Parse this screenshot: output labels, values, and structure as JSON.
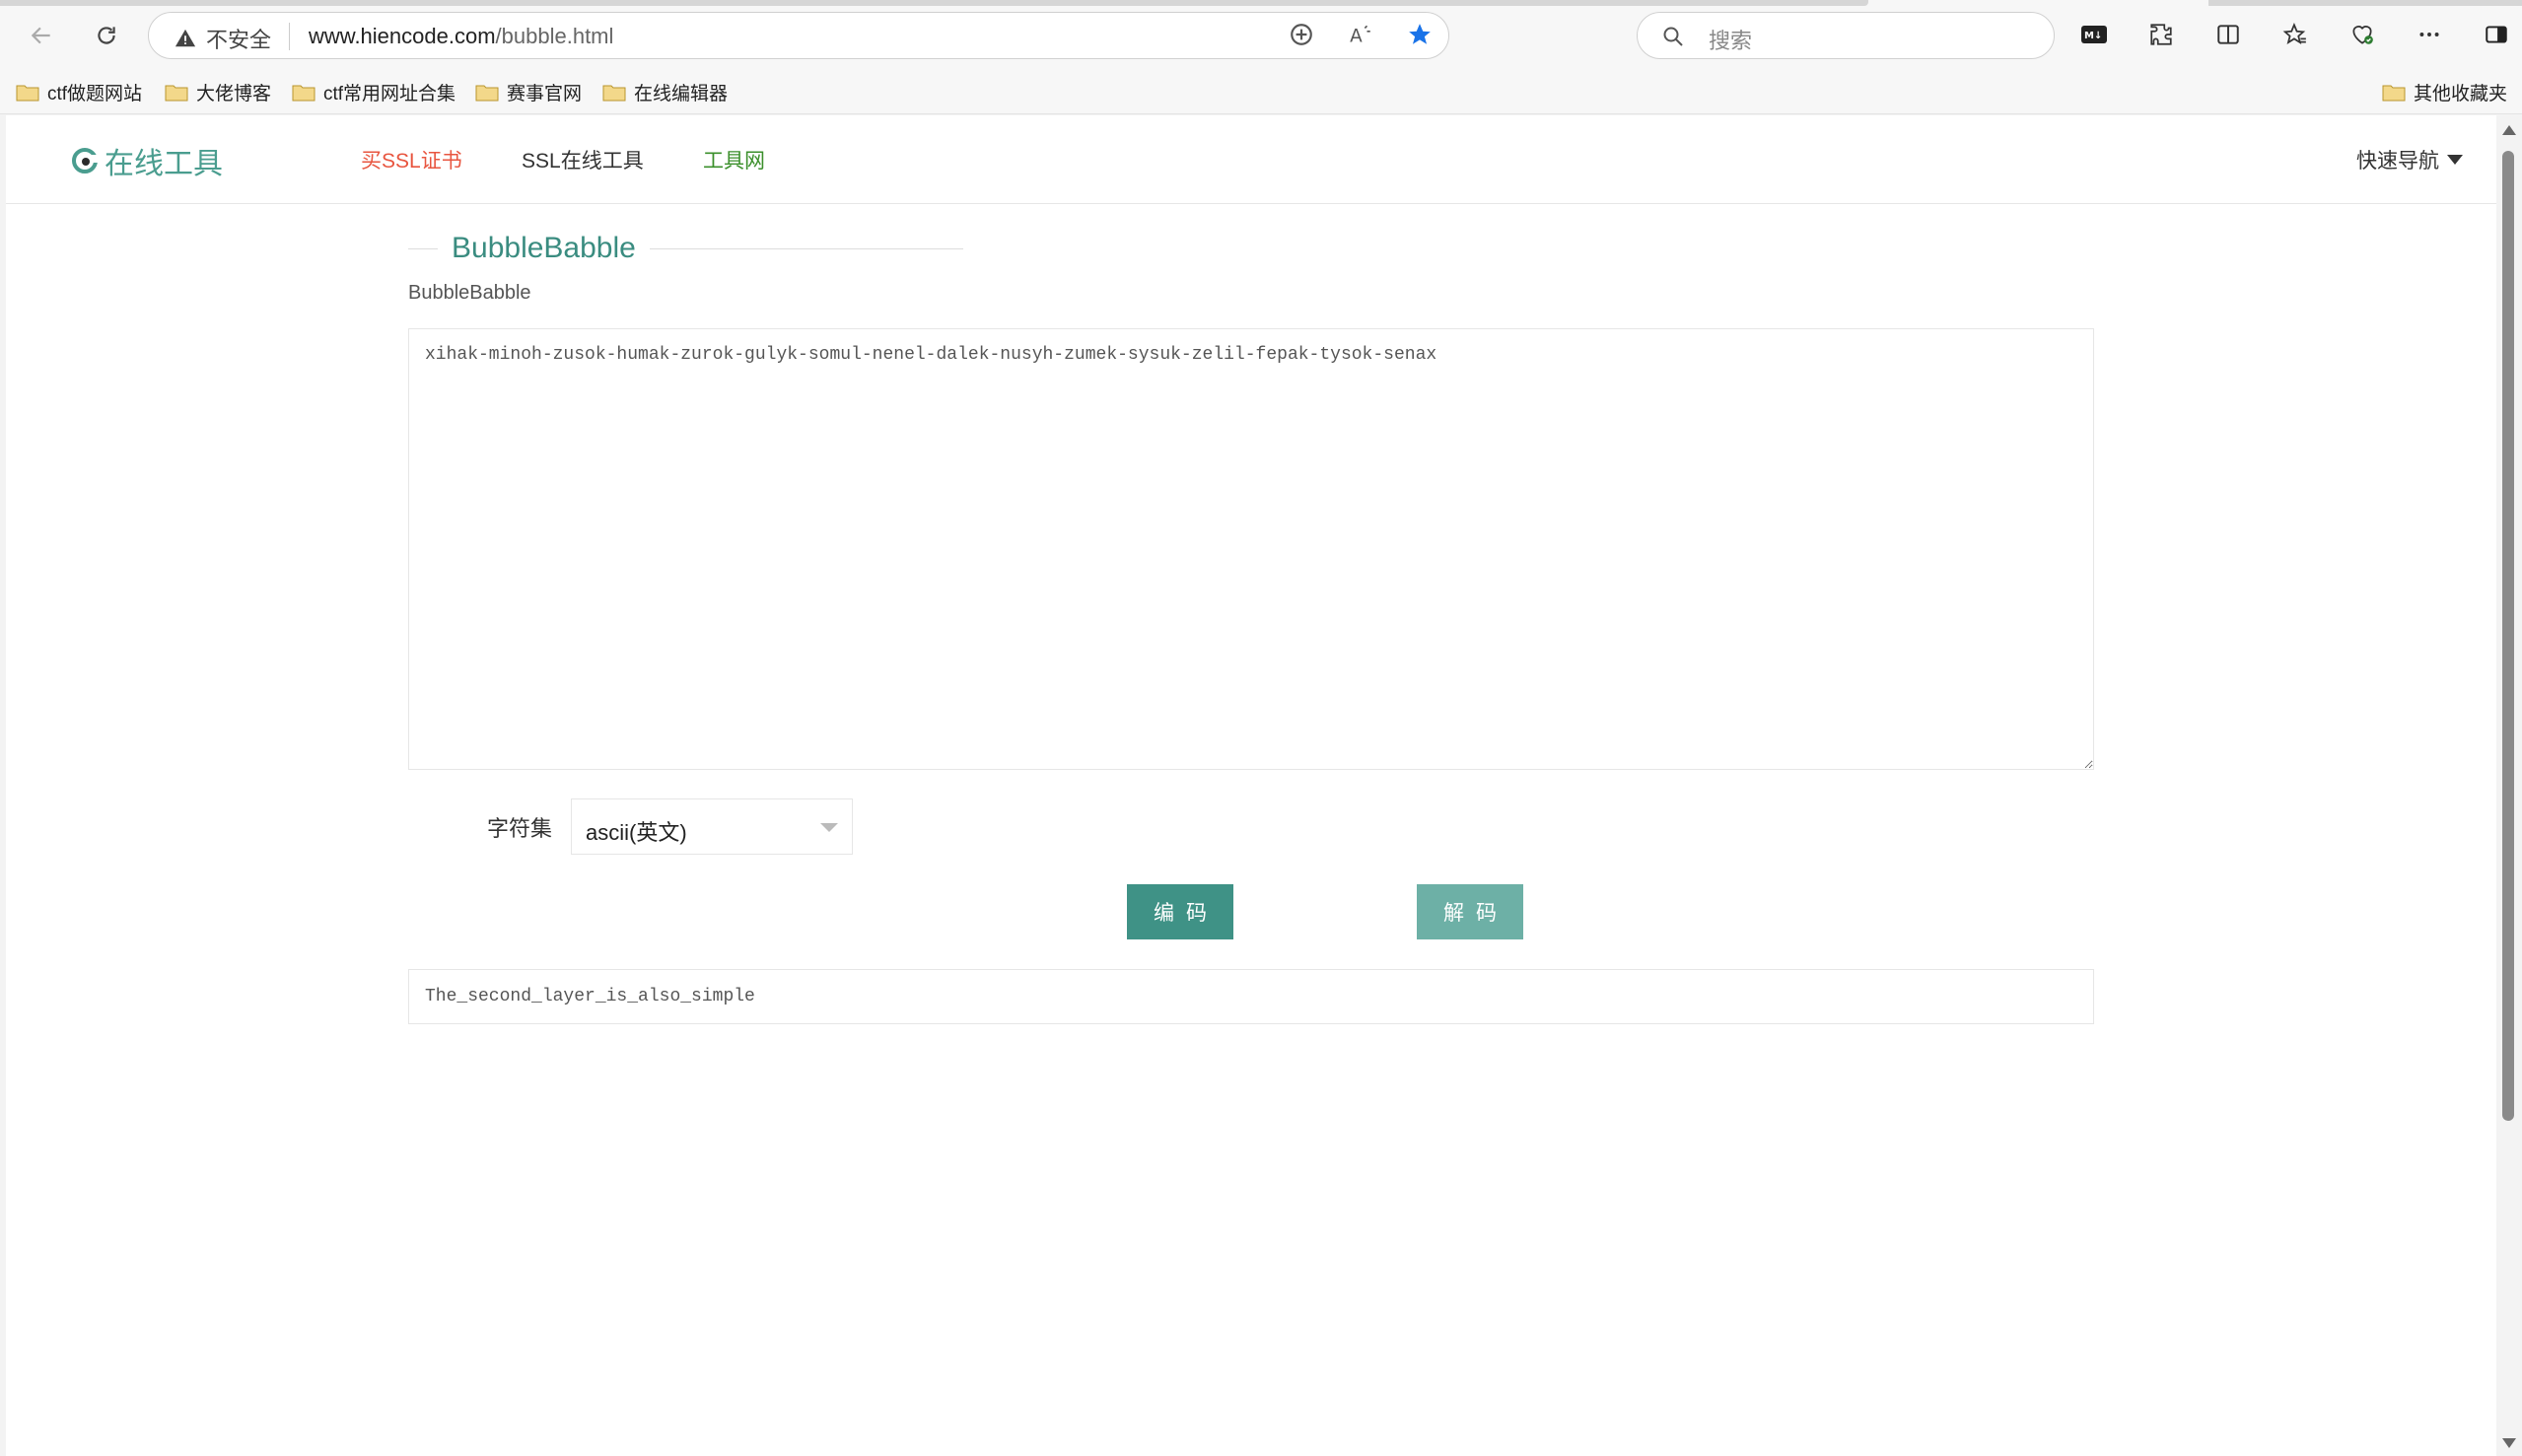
{
  "browser": {
    "url_warning": "不安全",
    "url_host": "www.hiencode.com",
    "url_path": "/bubble.html",
    "search_placeholder": "搜索",
    "bookmarks": [
      {
        "label": "ctf做题网站"
      },
      {
        "label": "大佬博客"
      },
      {
        "label": "ctf常用网址合集"
      },
      {
        "label": "赛事官网"
      },
      {
        "label": "在线编辑器"
      }
    ],
    "other_bookmarks": "其他收藏夹"
  },
  "site": {
    "logo_text": "在线工具",
    "nav": [
      {
        "label": "买SSL证书",
        "color": "#e8553f"
      },
      {
        "label": "SSL在线工具",
        "color": "#333333"
      },
      {
        "label": "工具网",
        "color": "#3b8f2b"
      }
    ],
    "quick_nav": "快速导航"
  },
  "tool": {
    "section_title": "BubbleBabble",
    "subtitle": "BubbleBabble",
    "input_value": "xihak-minoh-zusok-humak-zurok-gulyk-somul-nenel-dalek-nusyh-zumek-sysuk-zelil-fepak-tysok-senax",
    "charset_label": "字符集",
    "charset_selected": "ascii(英文)",
    "encode_label": "编码",
    "decode_label": "解码",
    "output_value": "The_second_layer_is_also_simple"
  },
  "colors": {
    "accent": "#3f9286",
    "accent_light": "#6db0a6",
    "star": "#1a73e8"
  }
}
